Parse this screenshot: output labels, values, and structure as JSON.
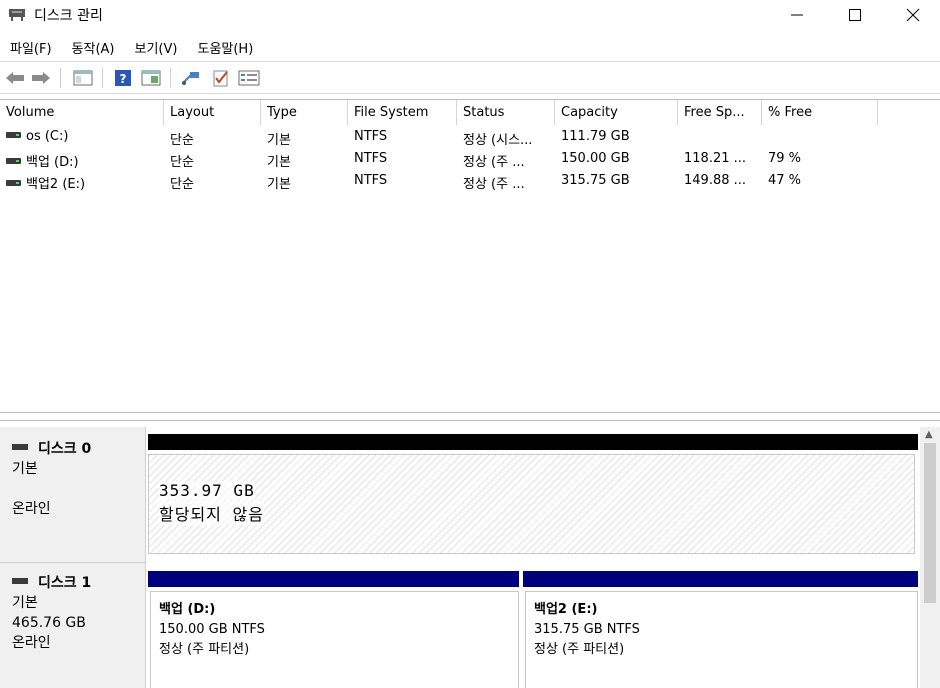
{
  "window": {
    "title": "디스크 관리"
  },
  "menu": [
    "파일(F)",
    "동작(A)",
    "보기(V)",
    "도움말(H)"
  ],
  "columns": [
    "Volume",
    "Layout",
    "Type",
    "File System",
    "Status",
    "Capacity",
    "Free Sp...",
    "% Free"
  ],
  "rows": [
    {
      "volume": "os (C:)",
      "layout": "단순",
      "type": "기본",
      "fs": "NTFS",
      "status": "정상 (시스...",
      "capacity": "111.79 GB",
      "free": "",
      "pct": ""
    },
    {
      "volume": "백업 (D:)",
      "layout": "단순",
      "type": "기본",
      "fs": "NTFS",
      "status": "정상 (주 ...",
      "capacity": "150.00 GB",
      "free": "118.21 ...",
      "pct": "79 %"
    },
    {
      "volume": "백업2 (E:)",
      "layout": "단순",
      "type": "기본",
      "fs": "NTFS",
      "status": "정상 (주 ...",
      "capacity": "315.75 GB",
      "free": "149.88 ...",
      "pct": "47 %"
    }
  ],
  "disks": [
    {
      "name": "디스크 0",
      "type": "기본",
      "size": "",
      "state": "온라인",
      "unallocated": {
        "size": "353.97 GB",
        "label": "할당되지 않음"
      }
    },
    {
      "name": "디스크 1",
      "type": "기본",
      "size": "465.76 GB",
      "state": "온라인",
      "partitions": [
        {
          "name": "백업  (D:)",
          "size": "150.00 GB NTFS",
          "status": "정상 (주 파티션)"
        },
        {
          "name": "백업2  (E:)",
          "size": "315.75 GB NTFS",
          "status": "정상 (주 파티션)"
        }
      ]
    }
  ],
  "colors": {
    "primary_partition_bar": "#00007f",
    "unallocated_bar": "#000000"
  }
}
